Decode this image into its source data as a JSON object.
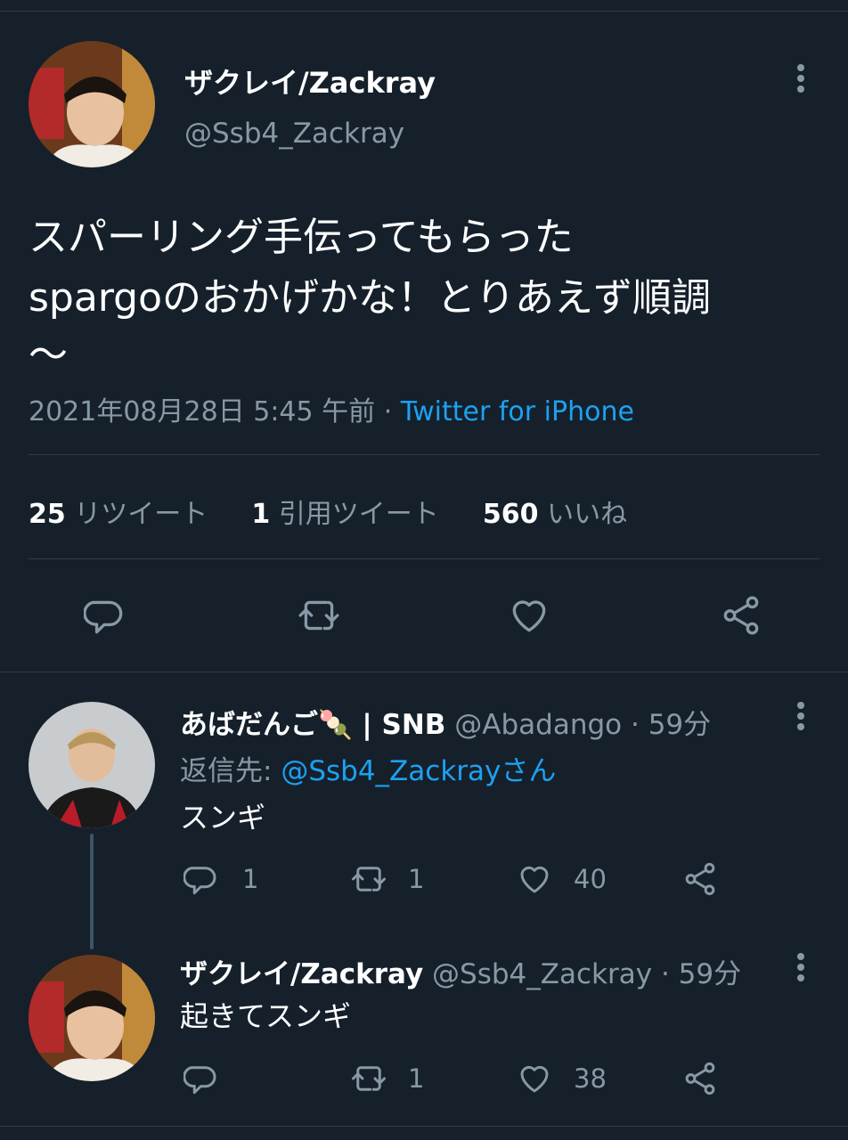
{
  "main_tweet": {
    "author_name": "ザクレイ/Zackray",
    "author_handle": "@Ssb4_Zackray",
    "text_lines": [
      "スパーリング手伝ってもらった",
      "spargoのおかげかな！とりあえず順調",
      "〜"
    ],
    "timestamp": "2021年08月28日 5:45 午前",
    "dot": "·",
    "client": "Twitter for iPhone",
    "stats": {
      "retweets_count": "25",
      "retweets_label": "リツイート",
      "quotes_count": "1",
      "quotes_label": "引用ツイート",
      "likes_count": "560",
      "likes_label": "いいね"
    }
  },
  "replies": [
    {
      "author_name": "あばだんご🍡 | SNB",
      "author_handle": "@Abadango",
      "time": "· 59分",
      "reply_to_label": "返信先:",
      "reply_to_handle": "@Ssb4_Zackrayさん",
      "text": "スンギ",
      "reply_count": "1",
      "retweet_count": "1",
      "like_count": "40"
    },
    {
      "author_name": "ザクレイ/Zackray",
      "author_handle": "@Ssb4_Zackray",
      "time": "· 59分",
      "text": "起きてスンギ",
      "reply_count": "",
      "retweet_count": "1",
      "like_count": "38"
    }
  ],
  "colors": {
    "background": "#15202b",
    "muted": "#8899a6",
    "link": "#1da1f2",
    "divider": "#2f3b47"
  },
  "icons": [
    "more-icon",
    "reply-icon",
    "retweet-icon",
    "like-icon",
    "share-icon"
  ]
}
